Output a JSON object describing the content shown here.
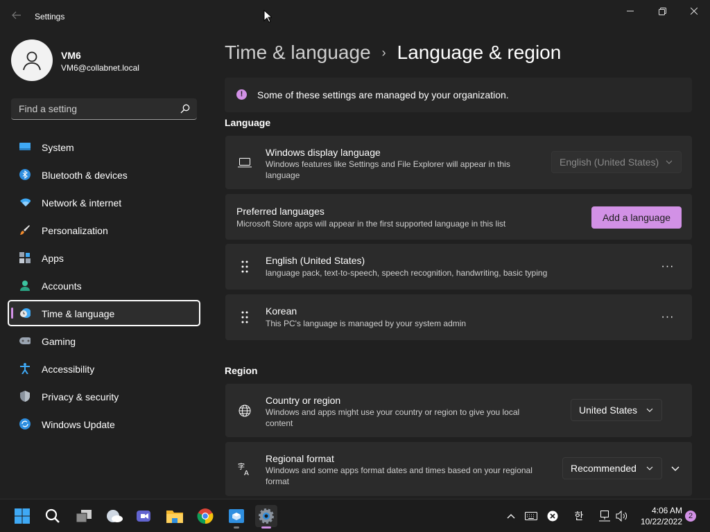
{
  "window": {
    "title": "Settings",
    "controls": {
      "minimize": "minimize",
      "maximize": "maximize",
      "close": "close"
    }
  },
  "profile": {
    "name": "VM6",
    "email": "VM6@collabnet.local"
  },
  "search": {
    "placeholder": "Find a setting"
  },
  "sidebar": {
    "items": [
      {
        "label": "System",
        "icon": "system-icon"
      },
      {
        "label": "Bluetooth & devices",
        "icon": "bluetooth-icon"
      },
      {
        "label": "Network & internet",
        "icon": "network-icon"
      },
      {
        "label": "Personalization",
        "icon": "brush-icon"
      },
      {
        "label": "Apps",
        "icon": "apps-icon"
      },
      {
        "label": "Accounts",
        "icon": "accounts-icon"
      },
      {
        "label": "Time & language",
        "icon": "time-language-icon",
        "active": true
      },
      {
        "label": "Gaming",
        "icon": "gamepad-icon"
      },
      {
        "label": "Accessibility",
        "icon": "accessibility-icon"
      },
      {
        "label": "Privacy & security",
        "icon": "shield-icon"
      },
      {
        "label": "Windows Update",
        "icon": "update-icon"
      }
    ]
  },
  "breadcrumb": {
    "parent": "Time & language",
    "separator": "›",
    "current": "Language & region"
  },
  "banner": {
    "text": "Some of these settings are managed by your organization."
  },
  "language": {
    "heading": "Language",
    "display_language": {
      "title": "Windows display language",
      "description": "Windows features like Settings and File Explorer will appear in this language",
      "value": "English (United States)",
      "disabled": true
    },
    "preferred": {
      "title": "Preferred languages",
      "description": "Microsoft Store apps will appear in the first supported language in this list",
      "add_button": "Add a language"
    },
    "languages": [
      {
        "name": "English (United States)",
        "detail": "language pack, text-to-speech, speech recognition, handwriting, basic typing"
      },
      {
        "name": "Korean",
        "detail": "This PC's language is managed by your system admin"
      }
    ],
    "more_label": "···"
  },
  "region": {
    "heading": "Region",
    "country": {
      "title": "Country or region",
      "description": "Windows and apps might use your country or region to give you local content",
      "value": "United States"
    },
    "format": {
      "title": "Regional format",
      "description": "Windows and some apps format dates and times based on your regional format",
      "value": "Recommended"
    }
  },
  "taskbar": {
    "apps": [
      "start-icon",
      "search-icon",
      "task-view-icon",
      "widgets-icon",
      "teams-chat-icon",
      "file-explorer-icon",
      "chrome-icon",
      "store-icon",
      "settings-icon"
    ],
    "tray": {
      "ime": "한"
    },
    "clock": {
      "time": "4:06 AM",
      "date": "10/22/2022"
    },
    "notifications": "2"
  },
  "colors": {
    "accent": "#d291e6",
    "background": "#202020",
    "card": "#2b2b2b"
  }
}
